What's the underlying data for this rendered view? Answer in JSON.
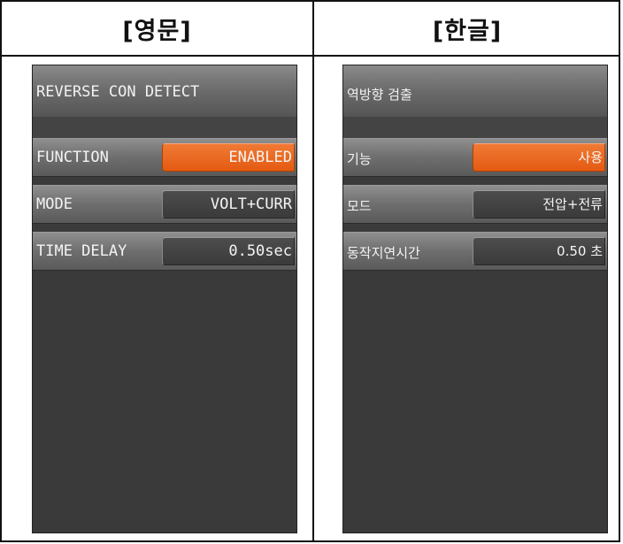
{
  "headers": {
    "english": "[영문]",
    "korean": "[한글]"
  },
  "english_panel": {
    "title": "REVERSE CON DETECT",
    "rows": [
      {
        "label": "FUNCTION",
        "value": "ENABLED"
      },
      {
        "label": "MODE",
        "value": "VOLT+CURR"
      },
      {
        "label": "TIME DELAY",
        "value": "0.50sec"
      }
    ]
  },
  "korean_panel": {
    "title": "역방향 검출",
    "rows": [
      {
        "label": "기능",
        "value": "사용"
      },
      {
        "label": "모드",
        "value": "전압+전류"
      },
      {
        "label": "동작지연시간",
        "value": "0.50 초"
      }
    ]
  },
  "colors": {
    "active_value": "#e8631d",
    "panel_bg": "#3b3b3b"
  }
}
